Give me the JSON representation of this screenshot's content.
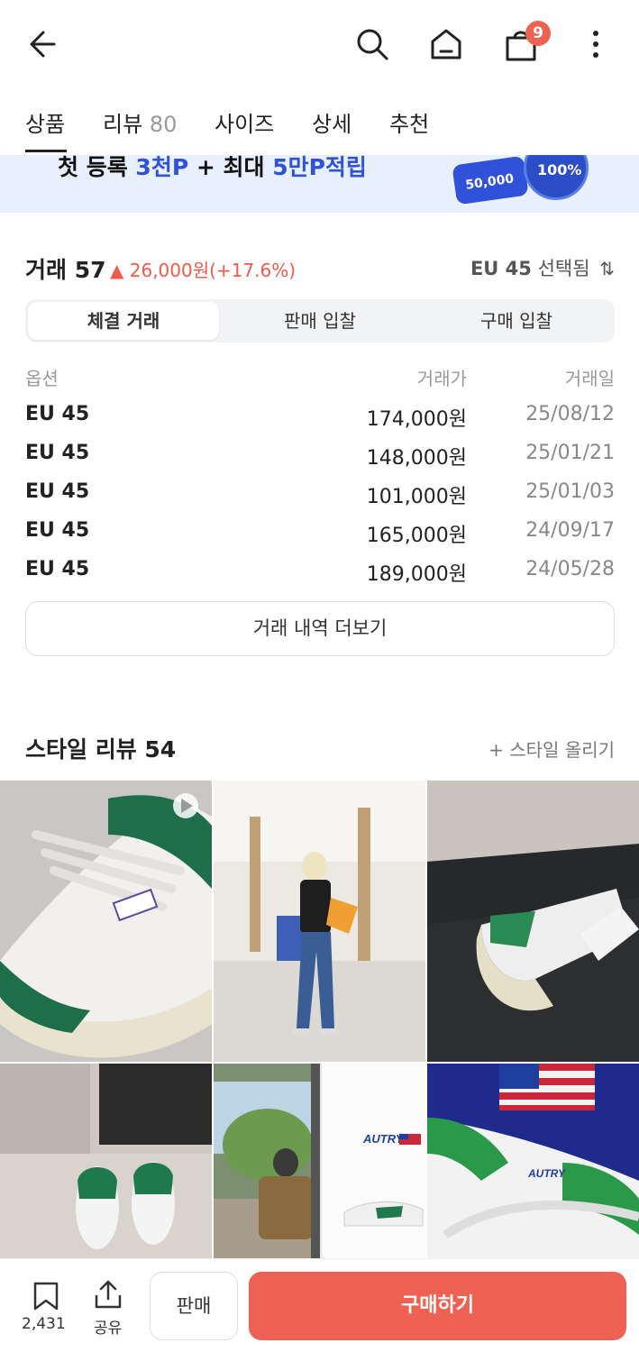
{
  "header": {
    "cart_badge": "9",
    "icons": [
      "back-arrow-icon",
      "search-icon",
      "home-icon",
      "shopping-bag-icon",
      "more-vertical-icon"
    ]
  },
  "tabs": [
    {
      "label": "상품",
      "count": "",
      "active": true
    },
    {
      "label": "리뷰",
      "count": "80"
    },
    {
      "label": "사이즈",
      "count": ""
    },
    {
      "label": "상세",
      "count": ""
    },
    {
      "label": "추천",
      "count": ""
    }
  ],
  "banner": {
    "text_prefix": "첫 등록 ",
    "text_hl1": "3천P",
    "text_mid": " + 최대 ",
    "text_hl2": "5만P적립",
    "coin1": "50,000",
    "coin2": "100%"
  },
  "trade": {
    "title": "거래 57",
    "change": "▲ 26,000원(+17.6%)",
    "size_selected": "EU 45",
    "size_suffix": "선택됨",
    "sort_icon": "⇅",
    "segments": [
      "체결 거래",
      "판매 입찰",
      "구매 입찰"
    ],
    "columns": [
      "옵션",
      "거래가",
      "거래일"
    ],
    "rows": [
      {
        "option": "EU 45",
        "price": "174,000원",
        "date": "25/08/12"
      },
      {
        "option": "EU 45",
        "price": "148,000원",
        "date": "25/01/21"
      },
      {
        "option": "EU 45",
        "price": "101,000원",
        "date": "25/01/03"
      },
      {
        "option": "EU 45",
        "price": "165,000원",
        "date": "24/09/17"
      },
      {
        "option": "EU 45",
        "price": "189,000원",
        "date": "24/05/28"
      }
    ],
    "more_label": "거래 내역 더보기"
  },
  "style": {
    "title": "스타일 리뷰 54",
    "upload_label": "+ 스타일 올리기",
    "photo_text": {
      "autry_logo_1": "AUTRY",
      "autry_logo_2": "AUTRY"
    }
  },
  "bottom": {
    "bookmark_count": "2,431",
    "share_label": "공유",
    "sell_label": "판매",
    "buy_label": "구매하기"
  },
  "colors": {
    "accent": "#ef6253",
    "banner_bg": "#e9f0fd",
    "highlight_blue": "#2f52d8",
    "up_red": "#ef5a4a"
  }
}
